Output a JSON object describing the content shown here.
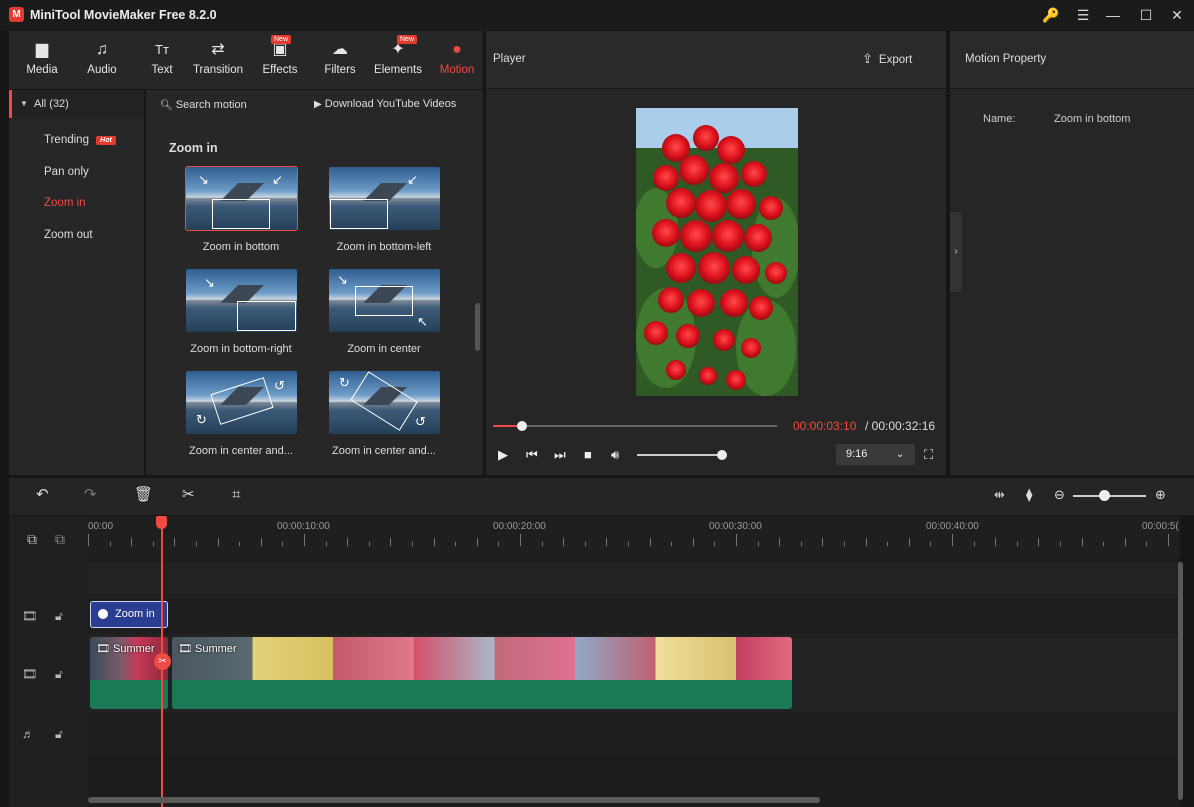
{
  "app": {
    "title": "MiniTool MovieMaker Free 8.2.0",
    "logo_letter": "M"
  },
  "window_controls": {
    "key": "🔑",
    "menu": "☰",
    "minimize": "—",
    "maximize": "☐",
    "close": "✕"
  },
  "toolbar": {
    "tools": [
      {
        "label": "Media",
        "icon": "folder-icon",
        "glyph": "▆"
      },
      {
        "label": "Audio",
        "icon": "music-icon",
        "glyph": "♫"
      },
      {
        "label": "Text",
        "icon": "text-icon",
        "glyph": "Tт"
      },
      {
        "label": "Transition",
        "icon": "transition-icon",
        "glyph": "⇄"
      },
      {
        "label": "Effects",
        "icon": "effects-icon",
        "glyph": "▣",
        "badge": "New"
      },
      {
        "label": "Filters",
        "icon": "filters-icon",
        "glyph": "☁"
      },
      {
        "label": "Elements",
        "icon": "elements-icon",
        "glyph": "✦",
        "badge": "New"
      },
      {
        "label": "Motion",
        "icon": "motion-icon",
        "glyph": "●",
        "active": true
      }
    ]
  },
  "categories": {
    "all": "All (32)",
    "items": [
      "Trending",
      "Pan only",
      "Zoom in",
      "Zoom out"
    ],
    "hot_badge": "Hot",
    "selected": "Zoom in"
  },
  "motion_browser": {
    "search_placeholder": "Search motion",
    "youtube_link": "Download YouTube Videos",
    "section_title": "Zoom in",
    "items": [
      "Zoom in bottom",
      "Zoom in bottom-left",
      "Zoom in bottom-right",
      "Zoom in center",
      "Zoom in center and...",
      "Zoom in center and..."
    ]
  },
  "player": {
    "label": "Player",
    "export_label": "Export",
    "time_current": "00:00:03:10",
    "time_separator": " / ",
    "time_total": "00:00:32:16",
    "aspect_ratio": "9:16",
    "progress_fraction": 0.103
  },
  "motion_property": {
    "title": "Motion Property",
    "name_label": "Name:",
    "name_value": "Zoom in bottom"
  },
  "timeline": {
    "ruler_labels": [
      "00:00",
      "00:00:10:00",
      "00:00:20:00",
      "00:00:30:00",
      "00:00:40:00",
      "00:00:5("
    ],
    "motion_clip_label": "Zoom in",
    "video_clips": [
      "Summer",
      "Summer"
    ]
  },
  "colors": {
    "accent": "#ef4b43",
    "clip_green": "#1a7a55",
    "motion_clip": "#2a3d91"
  }
}
